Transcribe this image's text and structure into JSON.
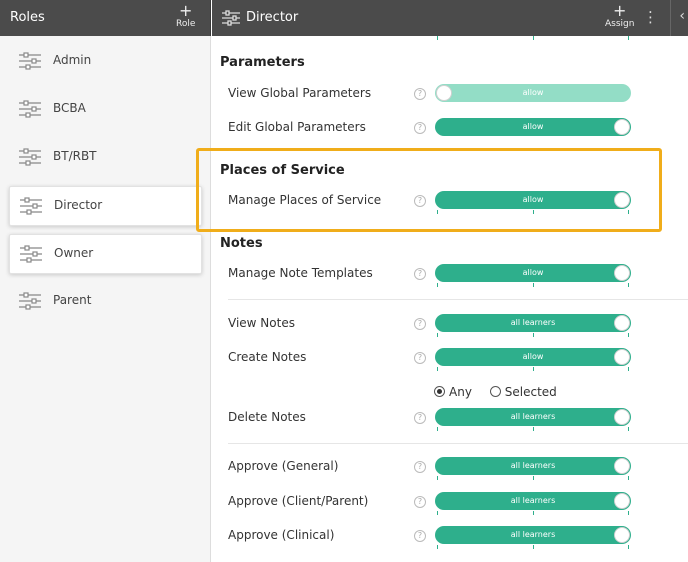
{
  "sidebar": {
    "title": "Roles",
    "add_label": "Role",
    "roles": [
      {
        "label": "Admin"
      },
      {
        "label": "BCBA"
      },
      {
        "label": "BT/RBT"
      },
      {
        "label": "Director",
        "selected": true
      },
      {
        "label": "Owner"
      },
      {
        "label": "Parent"
      }
    ]
  },
  "header": {
    "title": "Director",
    "assign_label": "Assign"
  },
  "sections": {
    "parameters": {
      "title": "Parameters",
      "rows": [
        {
          "label": "View Global Parameters",
          "value": "allow",
          "state": "off"
        },
        {
          "label": "Edit Global Parameters",
          "value": "allow",
          "state": "on"
        }
      ]
    },
    "places": {
      "title": "Places of Service",
      "rows": [
        {
          "label": "Manage Places of Service",
          "value": "allow",
          "state": "on"
        }
      ]
    },
    "notes": {
      "title": "Notes",
      "rows": [
        {
          "label": "Manage Note Templates",
          "value": "allow"
        },
        {
          "label": "View Notes",
          "value": "all learners"
        },
        {
          "label": "Create Notes",
          "value": "allow"
        },
        {
          "label": "Delete Notes",
          "value": "all learners"
        },
        {
          "label": "Approve (General)",
          "value": "all learners"
        },
        {
          "label": "Approve (Client/Parent)",
          "value": "all learners"
        },
        {
          "label": "Approve (Clinical)",
          "value": "all learners"
        }
      ],
      "radio": {
        "any": "Any",
        "selected": "Selected",
        "checked": "any"
      }
    }
  },
  "help_glyph": "?",
  "colors": {
    "header": "#4b4b4b",
    "toggle_on": "#2eaf8c",
    "toggle_light": "#93ddc6",
    "highlight": "#f0ad1a"
  }
}
